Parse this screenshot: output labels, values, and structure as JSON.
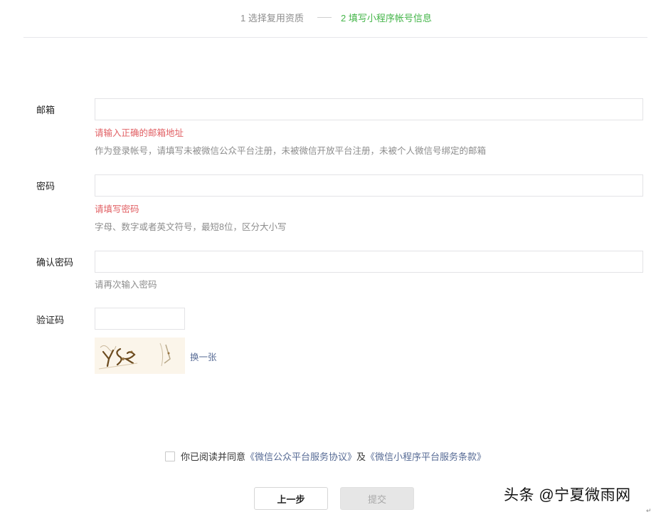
{
  "steps": {
    "step1": "1 选择复用资质",
    "step2": "2 填写小程序帐号信息"
  },
  "form": {
    "email": {
      "label": "邮箱",
      "value": "",
      "error": "请输入正确的邮箱地址",
      "tip": "作为登录帐号，请填写未被微信公众平台注册，未被微信开放平台注册，未被个人微信号绑定的邮箱"
    },
    "password": {
      "label": "密码",
      "value": "",
      "error": "请填写密码",
      "tip": "字母、数字或者英文符号，最短8位，区分大小写"
    },
    "confirm": {
      "label": "确认密码",
      "value": "",
      "tip": "请再次输入密码"
    },
    "captcha": {
      "label": "验证码",
      "value": "",
      "refresh_label": "换一张"
    }
  },
  "agreement": {
    "prefix": "你已阅读并同意",
    "link1": "《微信公众平台服务协议》",
    "conjunction": "及",
    "link2": "《微信小程序平台服务条款》",
    "checked": false
  },
  "buttons": {
    "prev_label": "上一步",
    "submit_label": "提交"
  },
  "watermark": "头条 @宁夏微雨网",
  "colors": {
    "active_step": "#44b549",
    "error": "#e15f63",
    "link": "#576b95",
    "tip": "#8d8d8d"
  }
}
